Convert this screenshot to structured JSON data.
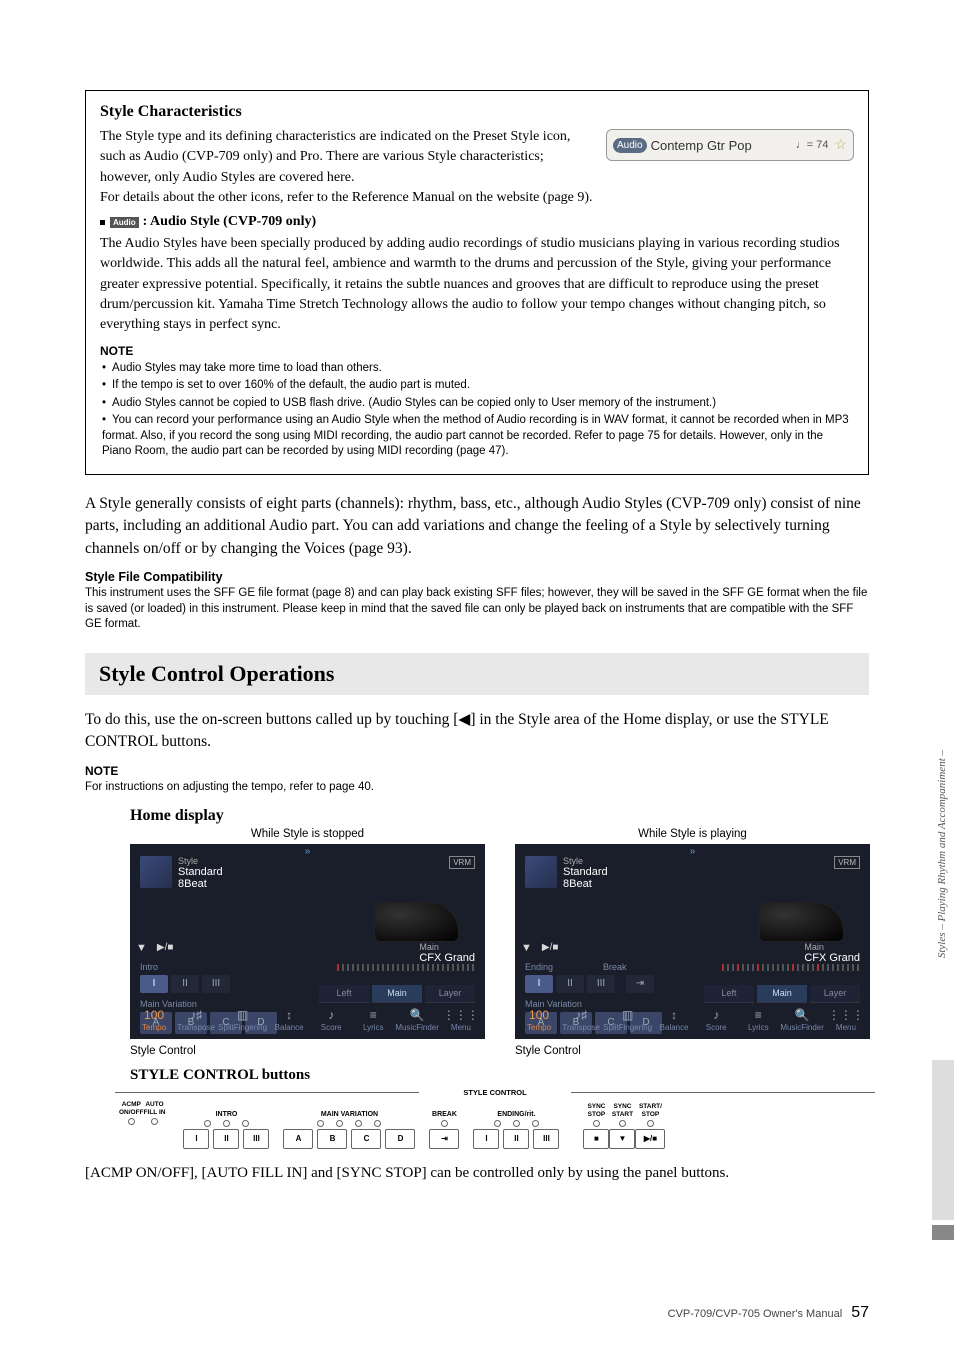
{
  "box": {
    "h": "Style Characteristics",
    "p1": "The Style type and its defining characteristics are indicated on the Preset Style icon, such as Audio (CVP-709 only) and Pro. There are various Style characteristics; however, only Audio Styles are covered here.",
    "p2": "For details about the other icons, refer to the Reference Manual on the website (page 9).",
    "audioHead": ": Audio Style (CVP-709 only)",
    "audioBadge": "Audio",
    "p3": "The Audio Styles have been specially produced by adding audio recordings of studio musicians playing in various recording studios worldwide. This adds all the natural feel, ambience and warmth to the drums and percussion of the Style, giving your performance greater expressive potential. Specifically, it retains the subtle nuances and grooves that are difficult to reproduce using the preset drum/percussion kit. Yamaha Time Stretch Technology allows the audio to follow your tempo changes without changing pitch, so everything stays in perfect sync.",
    "noteH": "NOTE",
    "notes": [
      "Audio Styles may take more time to load than others.",
      "If the tempo is set to over 160% of the default, the audio part is muted.",
      "Audio Styles cannot be copied to USB flash drive. (Audio Styles can be copied only to User memory of the instrument.)",
      "You can record your performance using an Audio Style when the method of Audio recording is in WAV format, it cannot be recorded when in MP3 format. Also, if you record the song using MIDI recording, the audio part cannot be recorded. Refer to page 75 for details. However, only in the Piano Room, the audio part can be recorded by using MIDI recording (page 47)."
    ],
    "icon": {
      "badge": "Audio",
      "name": "Contemp Gtr Pop",
      "tempo": "♩= 74",
      "star": "☆"
    }
  },
  "para1": "A Style generally consists of eight parts (channels): rhythm, bass, etc., although Audio Styles (CVP-709 only) consist of nine parts, including an additional Audio part. You can add variations and change the feeling of a Style by selectively turning channels on/off or by changing the Voices (page 93).",
  "sfc": {
    "h": "Style File Compatibility",
    "p": "This instrument uses the SFF GE file format (page 8) and can play back existing SFF files; however, they will be saved in the SFF GE format when the file is saved (or loaded) in this instrument. Please keep in mind that the saved file can only be played back on instruments that are compatible with the SFF GE format."
  },
  "section": "Style Control Operations",
  "intro": "To do this, use the on-screen buttons called up by touching [◀] in the Style area of the Home display, or use the STYLE CONTROL buttons.",
  "note2h": "NOTE",
  "note2": "For instructions on adjusting the tempo, refer to page 40.",
  "homeH": "Home display",
  "cap1": "While Style is stopped",
  "cap2": "While Style is playing",
  "belowCap": "Style Control",
  "ms": {
    "styleLabel": "Style",
    "styleName1": "Standard",
    "styleName2": "8Beat",
    "mainLabel": "Main",
    "mainName": "CFX Grand",
    "vrm": "VRM",
    "intro": "Intro",
    "ending": "Ending",
    "break": "Break",
    "mainVar": "Main Variation",
    "btnsI": [
      "I",
      "II",
      "III"
    ],
    "btnsA": [
      "A",
      "B",
      "C",
      "D"
    ],
    "lmr": [
      "Left",
      "Main",
      "Layer"
    ],
    "bottom": [
      {
        "ico": "100",
        "lbl": "Tempo"
      },
      {
        "ico": "♪",
        "lbl": "Transpose"
      },
      {
        "ico": "▦",
        "lbl": "SplitFingering"
      },
      {
        "ico": "↕",
        "lbl": "Balance"
      },
      {
        "ico": "♪",
        "lbl": "Score"
      },
      {
        "ico": "≡",
        "lbl": "Lyrics"
      },
      {
        "ico": "🔍",
        "lbl": "MusicFinder"
      },
      {
        "ico": "⋮⋮⋮",
        "lbl": "Menu"
      }
    ],
    "breakSym": "⇥"
  },
  "styleCtrlH": "STYLE CONTROL buttons",
  "panel": {
    "title": "STYLE CONTROL",
    "acmp": "ACMP\nON/OFF",
    "auto": "AUTO\nFILL IN",
    "intro": "INTRO",
    "mainv": "MAIN VARIATION",
    "break": "BREAK",
    "ending": "ENDING/rit.",
    "syncstop": "SYNC\nSTOP",
    "syncstart": "SYNC\nSTART",
    "startstop": "START/\nSTOP",
    "I": "I",
    "II": "II",
    "III": "III",
    "A": "A",
    "B": "B",
    "C": "C",
    "D": "D",
    "brk": "⇥",
    "rec": "■",
    "dn": "▼",
    "play": "▶/■"
  },
  "bottomPara": "[ACMP ON/OFF], [AUTO FILL IN] and [SYNC STOP] can be controlled only by using the panel buttons.",
  "side": "Styles – Playing Rhythm and Accompaniment –",
  "footer": "CVP-709/CVP-705 Owner's Manual",
  "pageNum": "57"
}
